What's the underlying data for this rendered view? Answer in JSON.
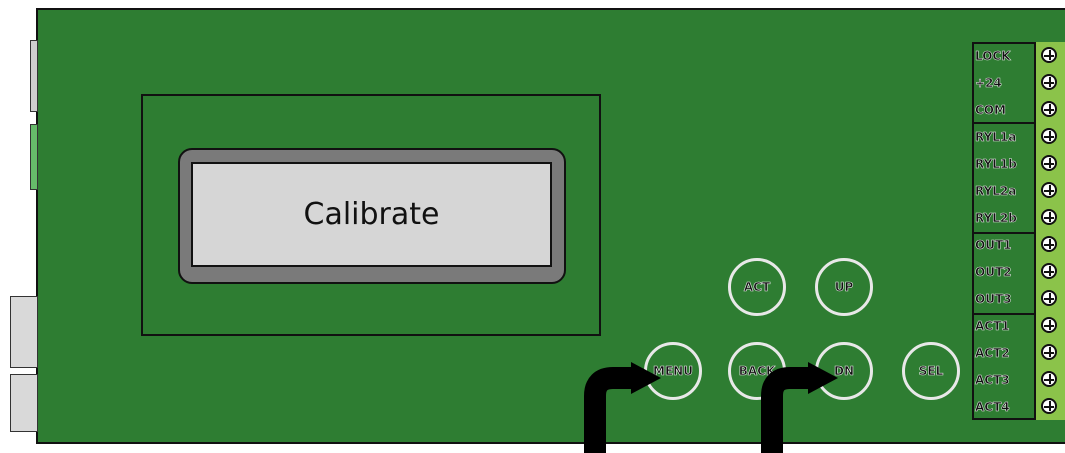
{
  "display": {
    "text": "Calibrate"
  },
  "buttons": {
    "act": "ACT",
    "up": "UP",
    "menu": "MENU",
    "back": "BACK",
    "dn": "DN",
    "sel": "SEL"
  },
  "terminals": [
    "LOCK",
    "+24",
    "COM",
    "RYL1a",
    "RYL1b",
    "RYL2a",
    "RYL2b",
    "OUT1",
    "OUT2",
    "OUT3",
    "ACT1",
    "ACT2",
    "ACT3",
    "ACT4"
  ],
  "colors": {
    "board": "#2e7d32",
    "screen": "#d6d6d6",
    "bezel": "#7a7a7a",
    "terminal_strip": "#8bc34a"
  }
}
